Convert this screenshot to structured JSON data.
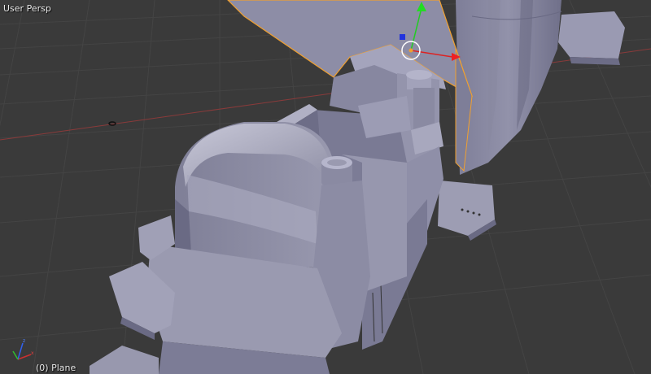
{
  "viewport": {
    "view_name": "User Persp",
    "active_object": "(0) Plane",
    "background_color": "#3a3a3a",
    "grid_color": "#444444",
    "x_axis_color": "#8a3a3a",
    "selection_outline_color": "#f0a030"
  },
  "gizmo": {
    "manipulator": [
      "x-arrow-red",
      "y-arrow-green",
      "z-handle-blue",
      "center-ring-white"
    ],
    "axis_indicator": [
      "x-axis",
      "y-axis",
      "z-axis"
    ]
  }
}
